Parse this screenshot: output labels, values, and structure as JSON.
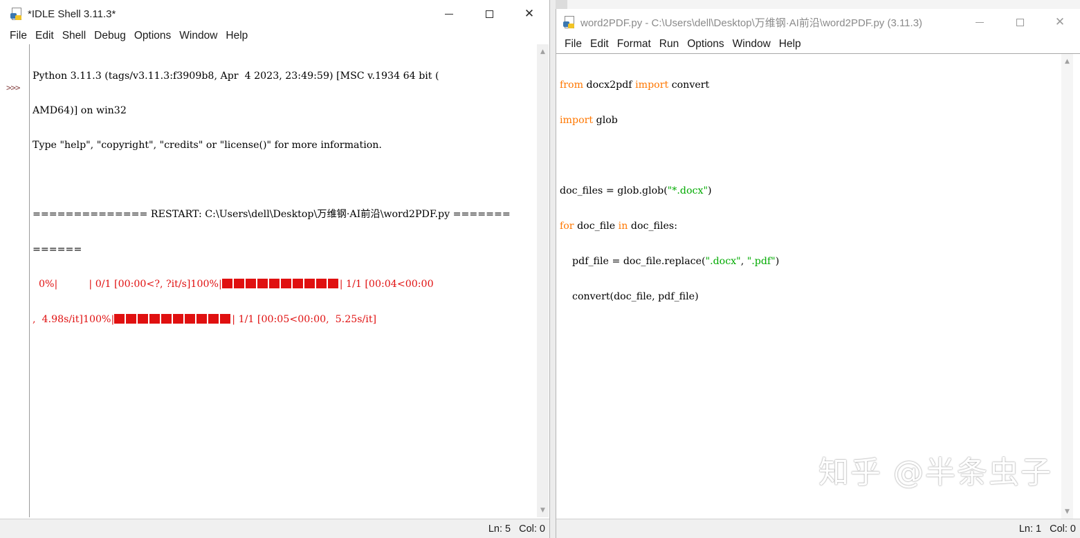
{
  "shell": {
    "title": "*IDLE Shell 3.11.3*",
    "menu": [
      "File",
      "Edit",
      "Shell",
      "Debug",
      "Options",
      "Window",
      "Help"
    ],
    "prompt": ">>>",
    "lines": {
      "l1": "Python 3.11.3 (tags/v3.11.3:f3909b8, Apr  4 2023, 23:49:59) [MSC v.1934 64 bit (",
      "l2": "AMD64)] on win32",
      "l3": "Type \"help\", \"copyright\", \"credits\" or \"license()\" for more information.",
      "l4": "============== RESTART: C:\\Users\\dell\\Desktop\\万维钢·AI前沿\\word2PDF.py =======",
      "l5": "======"
    },
    "progress": {
      "p1_start": "  0%|          | 0/1 [00:00<?, ?it/s]100%|",
      "p1_end": "| 1/1 [00:04<00:00",
      "p2_start": ",  4.98s/it]100%|",
      "p2_end": "| 1/1 [00:05<00:00,  5.25s/it]",
      "fraction": 1.0
    },
    "status": {
      "ln": "Ln: 5",
      "col": "Col: 0"
    }
  },
  "editor": {
    "title": "word2PDF.py - C:\\Users\\dell\\Desktop\\万维钢·AI前沿\\word2PDF.py (3.11.3)",
    "menu": [
      "File",
      "Edit",
      "Format",
      "Run",
      "Options",
      "Window",
      "Help"
    ],
    "code": {
      "c1_kw1": "from",
      "c1_mid": " docx2pdf ",
      "c1_kw2": "import",
      "c1_end": " convert",
      "c2_kw": "import",
      "c2_end": " glob",
      "c4_start": "doc_files = glob.glob(",
      "c4_str": "\"*.docx\"",
      "c4_end": ")",
      "c5_kw1": "for",
      "c5_mid": " doc_file ",
      "c5_kw2": "in",
      "c5_end": " doc_files:",
      "c6_start": "    pdf_file = doc_file.replace(",
      "c6_str1": "\".docx\"",
      "c6_mid": ", ",
      "c6_str2": "\".pdf\"",
      "c6_end": ")",
      "c7": "    convert(doc_file, pdf_file)"
    },
    "status": {
      "ln": "Ln: 1",
      "col": "Col: 0"
    },
    "watermark": "知乎 @半条虫子"
  },
  "icons": {
    "app": "python-idle-icon",
    "minimize": "minimize-icon",
    "maximize": "maximize-icon",
    "close": "close-icon"
  }
}
